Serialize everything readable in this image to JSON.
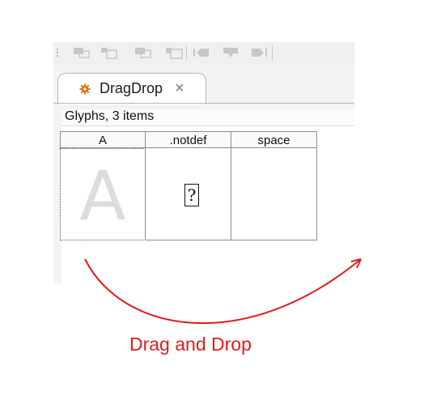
{
  "tab": {
    "label": "DragDrop",
    "close": "×"
  },
  "status": {
    "text": "Glyphs, 3 items"
  },
  "columns": [
    {
      "header": "A",
      "glyph": "A"
    },
    {
      "header": ".notdef",
      "glyph": "?"
    },
    {
      "header": "space",
      "glyph": ""
    }
  ],
  "caption": "Drag and Drop",
  "colors": {
    "caption": "#e31b1b",
    "arrow": "#e31b1b",
    "tab_border": "#a9b8cc"
  }
}
